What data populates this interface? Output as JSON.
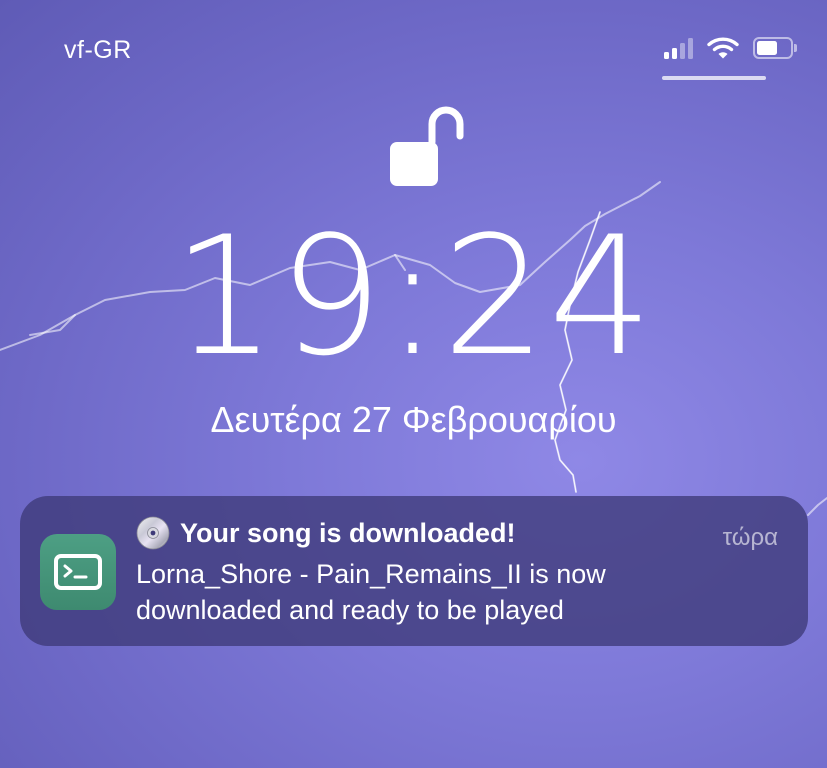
{
  "status_bar": {
    "carrier": "vf-GR",
    "signal_bars_active": 2,
    "signal_bars_total": 4,
    "wifi_icon": "wifi-icon",
    "battery_icon": "battery-icon"
  },
  "lock": {
    "icon": "unlocked-padlock-icon"
  },
  "clock": {
    "time": "19:24",
    "date": "Δευτέρα 27 Φεβρουαρίου"
  },
  "notification": {
    "app_icon": "terminal-app-icon",
    "title_icon": "cd-disc-icon",
    "title": "Your song is downloaded!",
    "time": "τώρα",
    "body_line1": "Lorna_Shore - Pain_Remains_II is now",
    "body_line2": "downloaded and ready to be played"
  },
  "colors": {
    "wallpaper": "#7e79d8",
    "notification_bg": "#3e3a78",
    "app_icon": "#4d9f84"
  }
}
